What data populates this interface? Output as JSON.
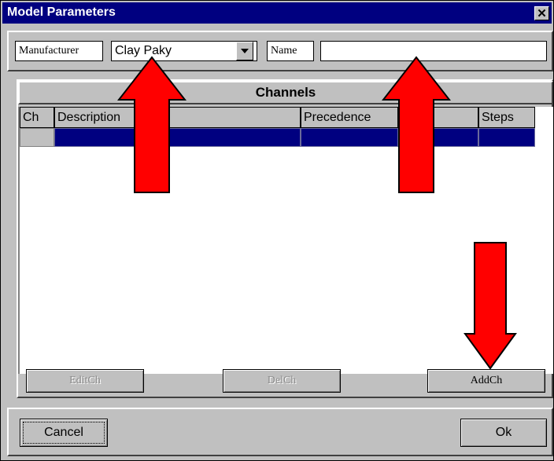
{
  "window": {
    "title": "Model Parameters",
    "close_glyph": "✕"
  },
  "top": {
    "manufacturer_label": "Manufacturer",
    "manufacturer_value": "Clay Paky",
    "name_label": "Name",
    "name_value": ""
  },
  "channels": {
    "header": "Channels",
    "columns": [
      "Ch",
      "Description",
      "Precedence",
      "Type",
      "Steps"
    ],
    "visible_column_text": {
      "type": "pe"
    }
  },
  "buttons": {
    "edit": "EditCh",
    "delete": "DelCh",
    "add": "AddCh",
    "cancel": "Cancel",
    "ok": "Ok"
  },
  "annotations": {
    "arrow_color": "#ff0000",
    "arrows": [
      "arrow-up-manufacturer",
      "arrow-up-name",
      "arrow-down-addch"
    ]
  },
  "colors": {
    "titlebar": "#000080",
    "selection": "#000080",
    "face": "#c0c0c0"
  }
}
